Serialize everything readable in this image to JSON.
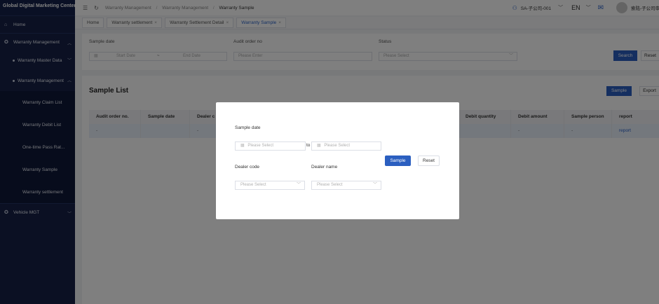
{
  "app": {
    "brand": "Global Digital Marketing Center"
  },
  "sidebar": {
    "items": [
      {
        "label": "Home"
      },
      {
        "label": "Warranty Management"
      },
      {
        "label": "Warranty Master Data"
      },
      {
        "label": "Warranty Management"
      },
      {
        "label": "Warranty Claim List"
      },
      {
        "label": "Warranty Debit List"
      },
      {
        "label": "One-time Pass Rat..."
      },
      {
        "label": "Warranty Sample"
      },
      {
        "label": "Warranty settlement"
      },
      {
        "label": "Vehicle MGT"
      }
    ]
  },
  "topbar": {
    "breadcrumb": [
      "Warranty Management",
      "Warranty Management",
      "Warranty Sample"
    ],
    "breadcrumb_sep": "/",
    "company": "SA-子公司-001",
    "language": "EN",
    "username": "索陆-子公司审核"
  },
  "tabs": [
    {
      "label": "Home",
      "closable": false
    },
    {
      "label": "Warranty settlement",
      "closable": true
    },
    {
      "label": "Warranty Settlement Detail",
      "closable": true
    },
    {
      "label": "Warranty Sample",
      "closable": true,
      "active": true
    }
  ],
  "filter": {
    "sample_date_label": "Sample date",
    "start_placeholder": "Start Date",
    "range_sep": "~",
    "end_placeholder": "End Date",
    "audit_order_label": "Audit order no",
    "audit_order_placeholder": "Please Enter",
    "status_label": "Status",
    "status_placeholder": "Please Select",
    "search_label": "Search",
    "reset_label": "Reset"
  },
  "list": {
    "title": "Sample List",
    "sample_button": "Sample",
    "export_button": "Export",
    "columns": [
      "Audit order no.",
      "Sample date",
      "Dealer c",
      "Debit quantity",
      "Debit amount",
      "Sample person",
      "report"
    ],
    "rows": [
      [
        "-",
        "",
        "-",
        "",
        "-",
        "-",
        "report"
      ]
    ]
  },
  "dialog": {
    "sample_date_label": "Sample date",
    "date_from_placeholder": "Please Select",
    "to_label": "to",
    "date_to_placeholder": "Please Select",
    "dealer_code_label": "Dealer code",
    "dealer_code_placeholder": "Please Select",
    "dealer_name_label": "Dealer name",
    "dealer_name_placeholder": "Please Select",
    "sample_button": "Sample",
    "reset_button": "Reset"
  },
  "colors": {
    "primary": "#2b5fc0",
    "sidebar_bg": "#162147",
    "mask": "rgba(0,0,0,0.5)"
  }
}
